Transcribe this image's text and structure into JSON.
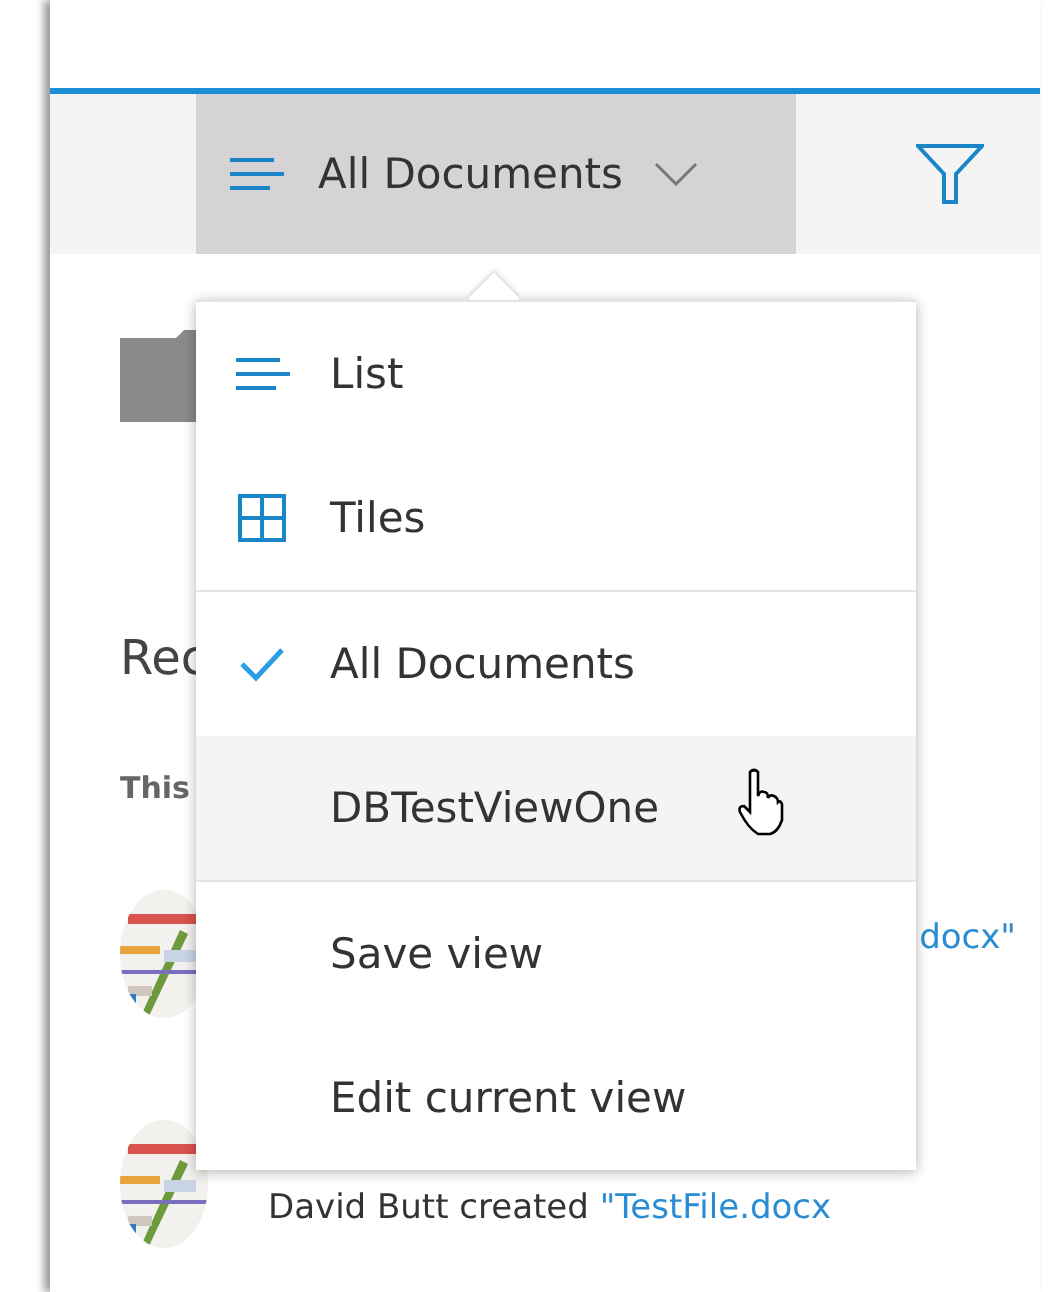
{
  "toolbar": {
    "view_button": {
      "label": "All Documents",
      "expanded": true
    }
  },
  "background": {
    "heading": "Rec",
    "subheading": "This",
    "activity": [
      {
        "kind": "partial",
        "link": "docx\""
      },
      {
        "kind": "full",
        "person": "David Butt",
        "action": "created",
        "link": "\"TestFile.docx"
      }
    ]
  },
  "view_menu": {
    "sections": [
      [
        {
          "kind": "list",
          "label": "List",
          "checked": false,
          "hovered": false
        },
        {
          "kind": "tiles",
          "label": "Tiles",
          "checked": false,
          "hovered": false
        }
      ],
      [
        {
          "kind": "view",
          "label": "All Documents",
          "checked": true,
          "hovered": false
        },
        {
          "kind": "view",
          "label": "DBTestViewOne",
          "checked": false,
          "hovered": true
        }
      ],
      [
        {
          "kind": "action",
          "label": "Save view",
          "checked": false,
          "hovered": false
        },
        {
          "kind": "action",
          "label": "Edit current view",
          "checked": false,
          "hovered": false
        }
      ]
    ]
  }
}
